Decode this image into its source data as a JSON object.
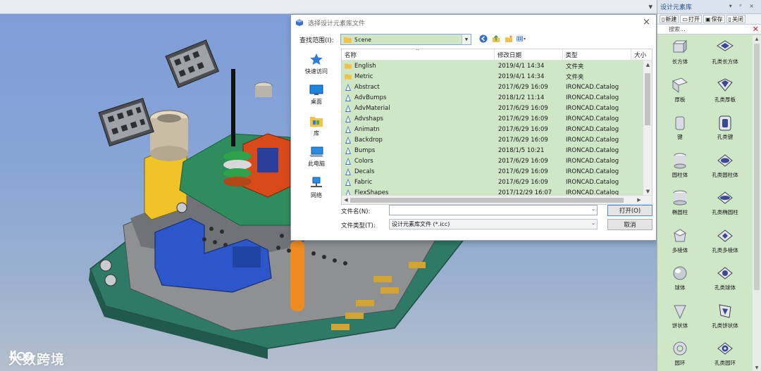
{
  "app": {
    "window_controls": "▾"
  },
  "watermark": {
    "logo": "大数跨境"
  },
  "dialog": {
    "title": "选择设计元素库文件",
    "close": "×",
    "look_in_label": "查找范围(I):",
    "look_in_value": "Scene",
    "places": [
      {
        "label": "快速访问",
        "icon": "star-icon"
      },
      {
        "label": "桌面",
        "icon": "desktop-icon"
      },
      {
        "label": "库",
        "icon": "library-icon"
      },
      {
        "label": "此电脑",
        "icon": "computer-icon"
      },
      {
        "label": "网络",
        "icon": "network-icon"
      }
    ],
    "columns": {
      "name": "名称",
      "date": "修改日期",
      "type": "类型",
      "size": "大小"
    },
    "files": [
      {
        "name": "English",
        "date": "2019/4/1 14:34",
        "type": "文件夹",
        "kind": "folder"
      },
      {
        "name": "Metric",
        "date": "2019/4/1 14:34",
        "type": "文件夹",
        "kind": "folder"
      },
      {
        "name": "Abstract",
        "date": "2017/6/29 16:09",
        "type": "IRONCAD.Catalog",
        "kind": "catalog"
      },
      {
        "name": "AdvBumps",
        "date": "2018/1/2 11:14",
        "type": "IRONCAD.Catalog",
        "kind": "catalog"
      },
      {
        "name": "AdvMaterial",
        "date": "2017/6/29 16:09",
        "type": "IRONCAD.Catalog",
        "kind": "catalog"
      },
      {
        "name": "Advshaps",
        "date": "2017/6/29 16:09",
        "type": "IRONCAD.Catalog",
        "kind": "catalog"
      },
      {
        "name": "Animatn",
        "date": "2017/6/29 16:09",
        "type": "IRONCAD.Catalog",
        "kind": "catalog"
      },
      {
        "name": "Backdrop",
        "date": "2017/6/29 16:09",
        "type": "IRONCAD.Catalog",
        "kind": "catalog"
      },
      {
        "name": "Bumps",
        "date": "2018/1/5 10:21",
        "type": "IRONCAD.Catalog",
        "kind": "catalog"
      },
      {
        "name": "Colors",
        "date": "2017/6/29 16:09",
        "type": "IRONCAD.Catalog",
        "kind": "catalog"
      },
      {
        "name": "Decals",
        "date": "2017/6/29 16:09",
        "type": "IRONCAD.Catalog",
        "kind": "catalog"
      },
      {
        "name": "Fabric",
        "date": "2017/6/29 16:09",
        "type": "IRONCAD.Catalog",
        "kind": "catalog"
      },
      {
        "name": "FlexShapes",
        "date": "2017/12/29 16:07",
        "type": "IRONCAD.Catalog",
        "kind": "catalog"
      }
    ],
    "filename_label": "文件名(N):",
    "filename_value": "",
    "filetype_label": "文件类型(T):",
    "filetype_value": "设计元素库文件 (*.icc)",
    "open_button": "打开(O)",
    "cancel_button": "取消"
  },
  "panel": {
    "title": "设计元素库",
    "title_controls": "▾ ᵖ ×",
    "tools": {
      "new": "新建",
      "open": "打开",
      "save": "保存",
      "close": "关闭"
    },
    "search_placeholder": "搜索...",
    "items": [
      {
        "label": "长方体",
        "icon": "box-icon"
      },
      {
        "label": "孔类长方体",
        "icon": "hole-box-icon"
      },
      {
        "label": "厚板",
        "icon": "plate-icon"
      },
      {
        "label": "孔类厚板",
        "icon": "hole-plate-icon"
      },
      {
        "label": "键",
        "icon": "key-icon"
      },
      {
        "label": "孔类键",
        "icon": "hole-key-icon"
      },
      {
        "label": "圆柱体",
        "icon": "cylinder-icon"
      },
      {
        "label": "孔类圆柱体",
        "icon": "hole-cylinder-icon"
      },
      {
        "label": "椭圆柱",
        "icon": "elliptic-cylinder-icon"
      },
      {
        "label": "孔类椭圆柱",
        "icon": "hole-elliptic-cylinder-icon"
      },
      {
        "label": "多棱体",
        "icon": "prism-icon"
      },
      {
        "label": "孔类多棱体",
        "icon": "hole-prism-icon"
      },
      {
        "label": "球体",
        "icon": "sphere-icon"
      },
      {
        "label": "孔类球体",
        "icon": "hole-sphere-icon"
      },
      {
        "label": "饼状体",
        "icon": "pie-icon"
      },
      {
        "label": "孔类饼状体",
        "icon": "hole-pie-icon"
      },
      {
        "label": "圆环",
        "icon": "torus-icon"
      },
      {
        "label": "孔类圆环",
        "icon": "hole-torus-icon"
      }
    ]
  }
}
